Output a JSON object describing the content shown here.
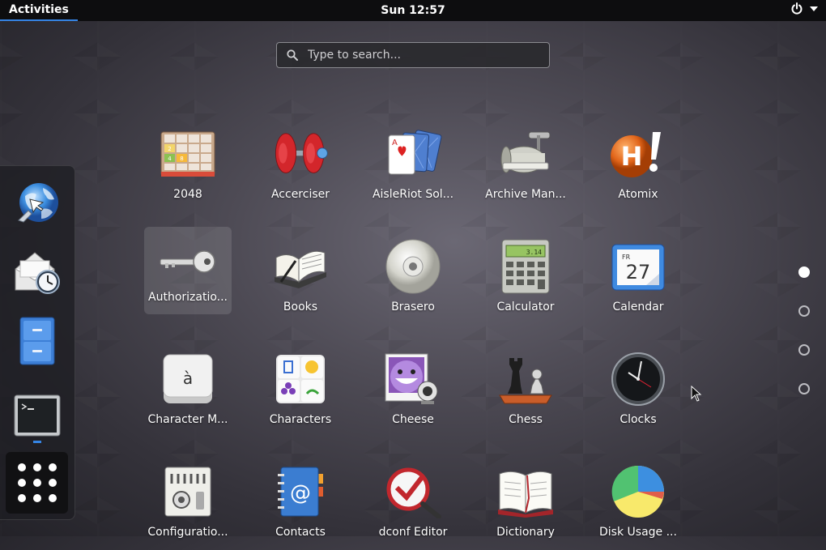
{
  "topbar": {
    "activities": "Activities",
    "clock": "Sun 12:57",
    "icons": [
      "power-icon",
      "chevron-down-icon"
    ]
  },
  "search": {
    "placeholder": "Type to search..."
  },
  "dash": {
    "items": [
      {
        "name": "web-browser",
        "icon": "globe-icon"
      },
      {
        "name": "mail-scheduler",
        "icon": "mail-clock-icon"
      },
      {
        "name": "file-manager",
        "icon": "file-cabinet-icon"
      },
      {
        "name": "terminal",
        "icon": "terminal-icon",
        "running": true
      }
    ],
    "show_apps_icon": "grid-dots-icon"
  },
  "apps": [
    {
      "label": "2048"
    },
    {
      "label": "Accerciser"
    },
    {
      "label": "AisleRiot Sol..."
    },
    {
      "label": "Archive Man..."
    },
    {
      "label": "Atomix"
    },
    {
      "label": "Authorizatio...",
      "focused": true
    },
    {
      "label": "Books"
    },
    {
      "label": "Brasero"
    },
    {
      "label": "Calculator"
    },
    {
      "label": "Calendar",
      "icon_text": {
        "month": "FR",
        "day": "27"
      }
    },
    {
      "label": "Character M...",
      "icon_text": "à"
    },
    {
      "label": "Characters"
    },
    {
      "label": "Cheese"
    },
    {
      "label": "Chess"
    },
    {
      "label": "Clocks"
    },
    {
      "label": "Configuratio..."
    },
    {
      "label": "Contacts"
    },
    {
      "label": "dconf Editor"
    },
    {
      "label": "Dictionary"
    },
    {
      "label": "Disk Usage ..."
    }
  ],
  "tile_2048": [
    "2",
    "4",
    "8"
  ],
  "calculator_display": "3.14",
  "pages": {
    "count": 4,
    "current": 1
  },
  "colors": {
    "accent": "#3584e4",
    "topbar": "#0d0d0f"
  }
}
